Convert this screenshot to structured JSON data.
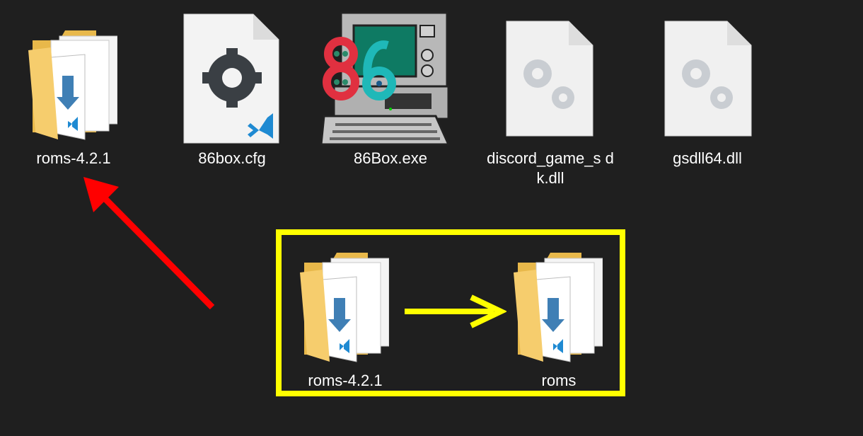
{
  "files": [
    {
      "name": "roms-4.2.1",
      "icon": "folder-icon"
    },
    {
      "name": "86box.cfg",
      "icon": "cfg-file-icon"
    },
    {
      "name": "86Box.exe",
      "icon": "86box-app-icon"
    },
    {
      "name": "discord_game_s dk.dll",
      "icon": "dll-file-icon"
    },
    {
      "name": "gsdll64.dll",
      "icon": "dll-file-icon"
    }
  ],
  "rename_hint": {
    "from": "roms-4.2.1",
    "to": "roms"
  },
  "colors": {
    "background": "#1f1f1f",
    "highlight": "#ffff00",
    "pointer_arrow": "#ff0000",
    "folder": "#f6cd6d",
    "vscode_blue": "#1f8ad2"
  }
}
